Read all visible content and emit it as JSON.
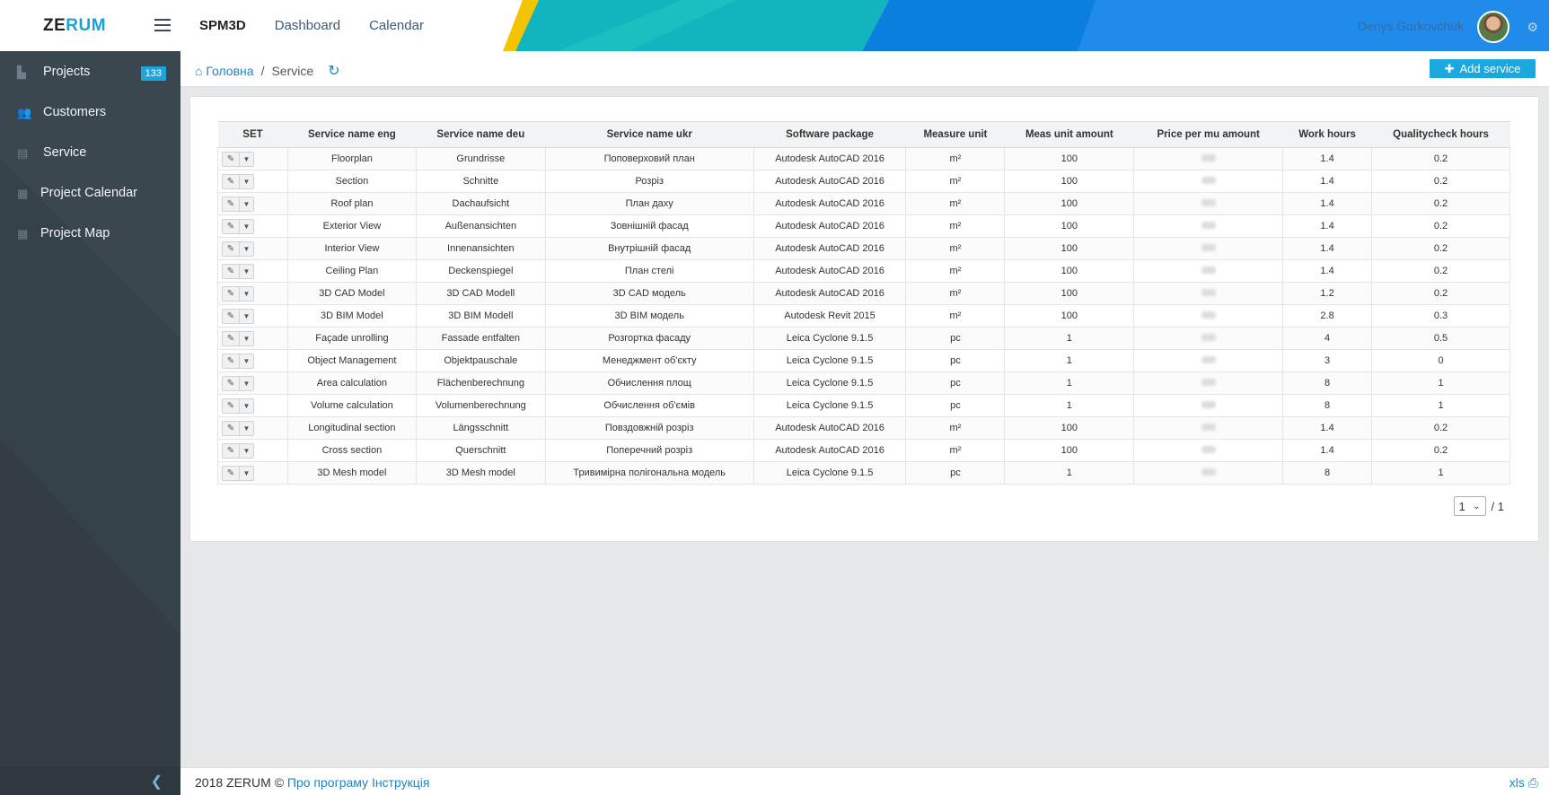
{
  "header": {
    "logo_part1": "ZE",
    "logo_part2": "RUM",
    "brand": "SPM3D",
    "nav": [
      "Dashboard",
      "Calendar"
    ],
    "user_name": "Denys Gorkovchuk",
    "colors": {
      "teal": "#12b5be",
      "blue": "#0a7fe0",
      "yellow": "#f5c400"
    }
  },
  "sidebar": {
    "items": [
      {
        "label": "Projects",
        "icon": "building-icon",
        "badge": "133"
      },
      {
        "label": "Customers",
        "icon": "users-icon"
      },
      {
        "label": "Service",
        "icon": "document-icon"
      },
      {
        "label": "Project Calendar",
        "icon": "calendar-icon"
      },
      {
        "label": "Project Map",
        "icon": "calendar-icon"
      }
    ]
  },
  "breadcrumb": {
    "home": "Головна",
    "sep": "/",
    "current": "Service"
  },
  "add_button": "Add service",
  "table": {
    "headers": [
      "SET",
      "Service name eng",
      "Service name deu",
      "Service name ukr",
      "Software package",
      "Measure unit",
      "Meas unit amount",
      "Price per mu amount",
      "Work hours",
      "Qualitycheck hours"
    ],
    "rows": [
      [
        "Floorplan",
        "Grundrisse",
        "Поповерховий план",
        "Autodesk AutoCAD 2016",
        "m²",
        "100",
        "1.4",
        "0.2"
      ],
      [
        "Section",
        "Schnitte",
        "Розріз",
        "Autodesk AutoCAD 2016",
        "m²",
        "100",
        "1.4",
        "0.2"
      ],
      [
        "Roof plan",
        "Dachaufsicht",
        "План даху",
        "Autodesk AutoCAD 2016",
        "m²",
        "100",
        "1.4",
        "0.2"
      ],
      [
        "Exterior View",
        "Außenansichten",
        "Зовнішній фасад",
        "Autodesk AutoCAD 2016",
        "m²",
        "100",
        "1.4",
        "0.2"
      ],
      [
        "Interior View",
        "Innenansichten",
        "Внутрішній фасад",
        "Autodesk AutoCAD 2016",
        "m²",
        "100",
        "1.4",
        "0.2"
      ],
      [
        "Ceiling Plan",
        "Deckenspiegel",
        "План стелі",
        "Autodesk AutoCAD 2016",
        "m²",
        "100",
        "1.4",
        "0.2"
      ],
      [
        "3D CAD Model",
        "3D CAD Modell",
        "3D CAD модель",
        "Autodesk AutoCAD 2016",
        "m²",
        "100",
        "1.2",
        "0.2"
      ],
      [
        "3D BIM Model",
        "3D BIM Modell",
        "3D BIM модель",
        "Autodesk Revit 2015",
        "m²",
        "100",
        "2.8",
        "0.3"
      ],
      [
        "Façade unrolling",
        "Fassade entfalten",
        "Розгортка фасаду",
        "Leica Cyclone 9.1.5",
        "pc",
        "1",
        "4",
        "0.5"
      ],
      [
        "Object Management",
        "Objektpauschale",
        "Менеджмент об'єкту",
        "Leica Cyclone 9.1.5",
        "pc",
        "1",
        "3",
        "0"
      ],
      [
        "Area calculation",
        "Flächenberechnung",
        "Обчислення площ",
        "Leica Cyclone 9.1.5",
        "pc",
        "1",
        "8",
        "1"
      ],
      [
        "Volume calculation",
        "Volumenberechnung",
        "Обчислення об'ємів",
        "Leica Cyclone 9.1.5",
        "pc",
        "1",
        "8",
        "1"
      ],
      [
        "Longitudinal section",
        "Längsschnitt",
        "Повздовжній розріз",
        "Autodesk AutoCAD 2016",
        "m²",
        "100",
        "1.4",
        "0.2"
      ],
      [
        "Cross section",
        "Querschnitt",
        "Поперечний розріз",
        "Autodesk AutoCAD 2016",
        "m²",
        "100",
        "1.4",
        "0.2"
      ],
      [
        "3D Mesh model",
        "3D Mesh model",
        "Тривимірна полігональна модель",
        "Leica Cyclone 9.1.5",
        "pc",
        "1",
        "8",
        "1"
      ]
    ]
  },
  "pager": {
    "page": "1",
    "total": "/ 1"
  },
  "footer": {
    "copyright": "2018 ZERUM ©",
    "link1": "Про програму",
    "link2": "Інструкція",
    "xls": "xls"
  }
}
